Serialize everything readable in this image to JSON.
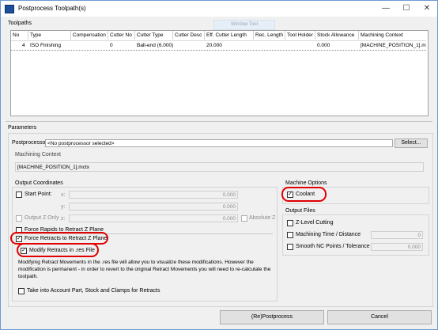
{
  "window": {
    "title": "Postprocess Toolpath(s)",
    "minimize_glyph": "—",
    "maximize_glyph": "☐",
    "close_glyph": "✕"
  },
  "toolpaths": {
    "label": "Toolpaths",
    "hover_button": "Window Tool",
    "columns": [
      "No",
      "Type",
      "Compensation",
      "Cutter No",
      "Cutter Type",
      "Cutter Desc",
      "Eff. Cutter Length",
      "Rec. Length",
      "Tool Holder",
      "Stock Allowance",
      "Machining Context"
    ],
    "rows": [
      {
        "no": "4",
        "type": "ISO Finishing",
        "compensation": "",
        "cutter_no": "0",
        "cutter_type": "Ball-end (6.000)",
        "cutter_desc": "",
        "eff_length": "20.000",
        "rec_length": "",
        "tool_holder": "",
        "stock_allowance": "0.000",
        "context": "[MACHINE_POSITION_1].mctx"
      }
    ]
  },
  "parameters": {
    "label": "Parameters",
    "postprocessor_label": "Postprocessor",
    "postprocessor_value": "<No postprocessor selected>",
    "select_button": "Select...",
    "machining_context_label": "Machining Context",
    "machining_context_value": "[MACHINE_POSITION_1].mctx"
  },
  "output_coordinates": {
    "label": "Output Coordinates",
    "start_point": {
      "label": "Start Point:",
      "checked": false
    },
    "x_label": "x:",
    "x_value": "0.000",
    "y_label": "y:",
    "y_value": "0.000",
    "output_z_only": {
      "label": "Output Z Only",
      "checked": false
    },
    "z_label": "z:",
    "z_value": "0.000",
    "absolute_z": {
      "label": "Absolute Z",
      "checked": false
    },
    "force_rapids": {
      "label": "Force Rapids to Retract Z Plane",
      "checked": false
    },
    "force_retracts": {
      "label": "Force Retracts to Retract Z Plane",
      "checked": true
    },
    "modify_retracts": {
      "label": "Modify Retracts in .res File",
      "checked": true
    },
    "description": "Modifying Retract Movements in the .res file will allow you to visualize these modifications. However the modification is permanent - in order to revert to the original Retract Movements you will need to re-calculate the toolpath.",
    "take_into_account": {
      "label": "Take into Account Part, Stock and Clamps for Retracts",
      "checked": false
    }
  },
  "machine_options": {
    "label": "Machine Options",
    "coolant": {
      "label": "Coolant",
      "checked": true
    }
  },
  "output_files": {
    "label": "Output Files",
    "z_level_cutting": {
      "label": "Z-Level Cutting",
      "checked": false
    },
    "machining_time": {
      "label": "Machining Time / Distance",
      "checked": false,
      "value": "0"
    },
    "smooth_nc": {
      "label": "Smooth NC Points / Tolerance",
      "checked": false,
      "value": "0.000"
    }
  },
  "buttons": {
    "postprocess": "(Re)Postprocess",
    "cancel": "Cancel"
  },
  "colors": {
    "highlight": "#e00000",
    "title_border": "#6b9bd1"
  }
}
